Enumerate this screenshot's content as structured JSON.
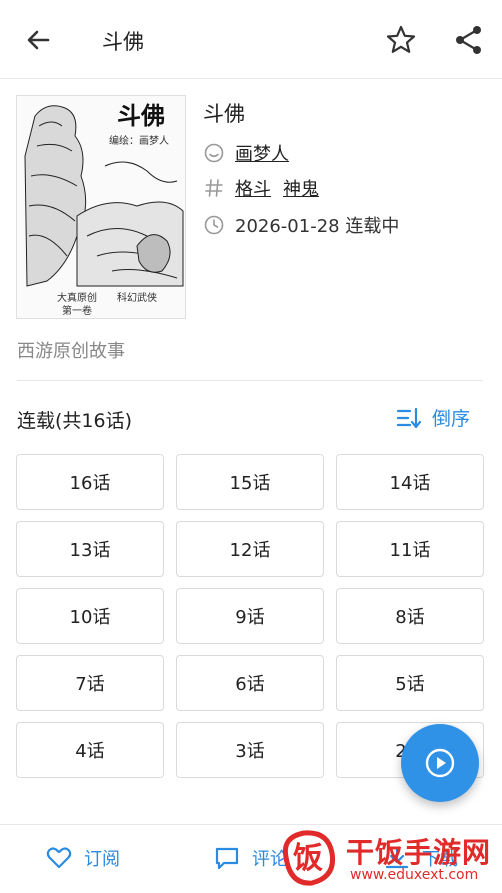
{
  "header": {
    "title": "斗佛"
  },
  "book": {
    "title": "斗佛",
    "author": "画梦人",
    "tags": [
      "格斗",
      "神鬼"
    ],
    "date_status": "2026-01-28 连载中",
    "description": "西游原创故事",
    "cover_text": [
      "斗佛",
      "编绘：画梦人",
      "大真原创",
      "科幻武侠",
      "第一卷"
    ]
  },
  "chapters": {
    "header": "连载(共16话)",
    "sort_label": "倒序",
    "items": [
      "16话",
      "15话",
      "14话",
      "13话",
      "12话",
      "11话",
      "10话",
      "9话",
      "8话",
      "7话",
      "6话",
      "5话",
      "4话",
      "3话",
      "2话"
    ]
  },
  "bottom": {
    "subscribe": "订阅",
    "comment": "评论",
    "download": "下载"
  },
  "watermark": {
    "site": "干饭手游网",
    "url": "www.eduxext.com",
    "logo_char": "饭"
  },
  "colors": {
    "accent": "#2a8be0",
    "fab": "#2f92e6",
    "watermark": "#e12b2b"
  }
}
